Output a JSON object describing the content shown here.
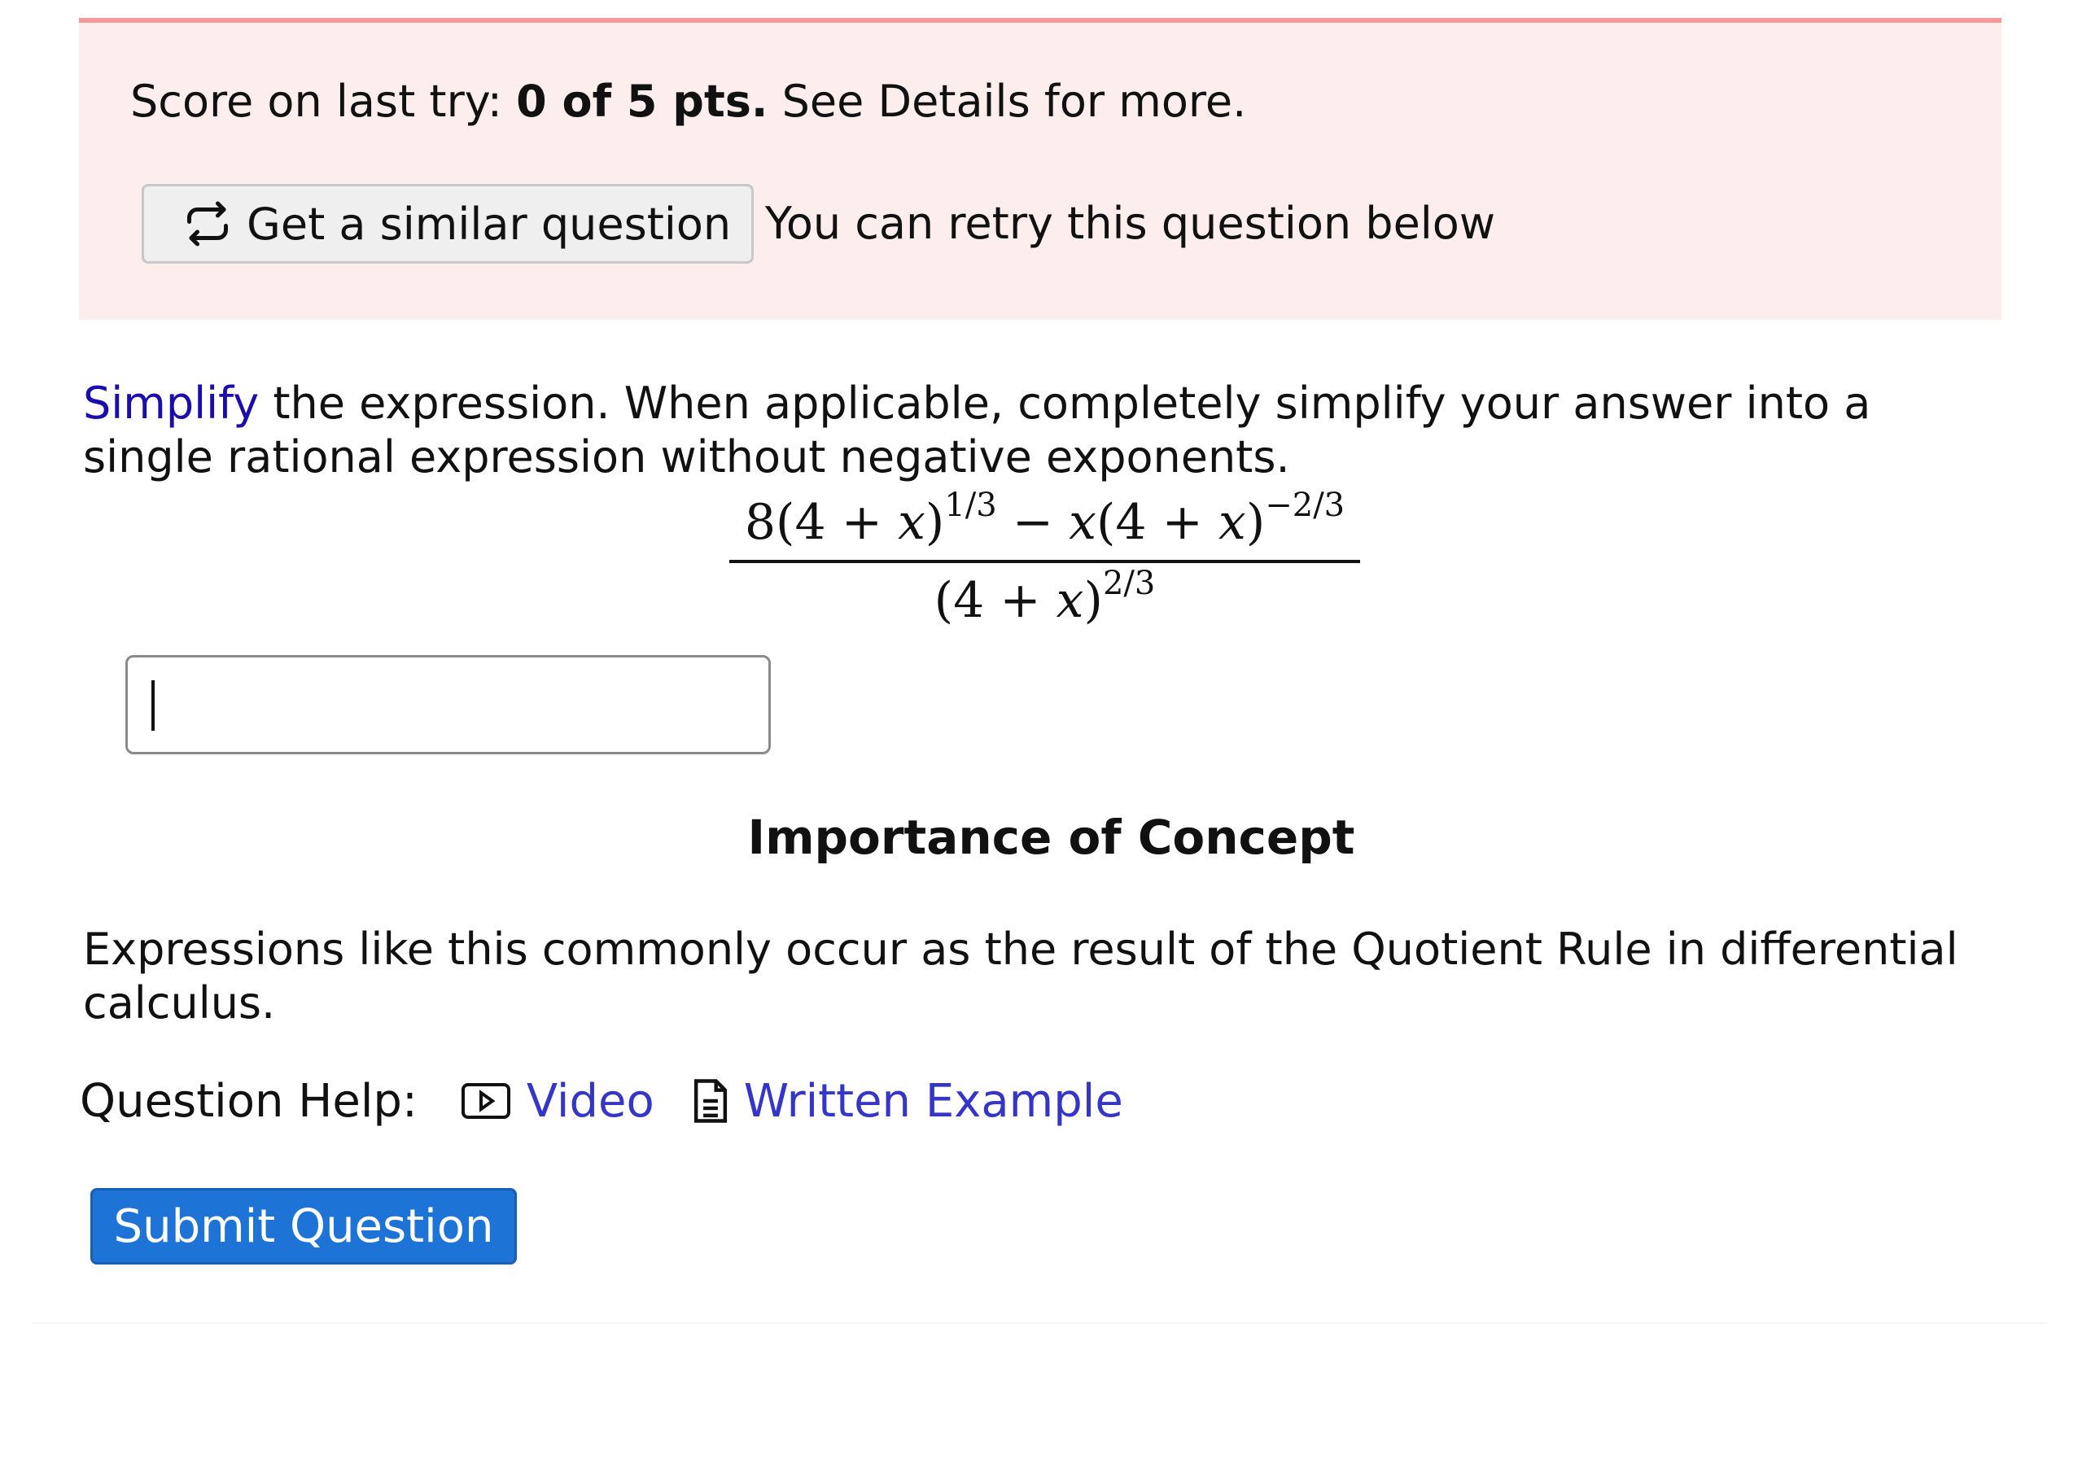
{
  "score_banner": {
    "prefix": "Score on last try: ",
    "score": "0 of 5 pts.",
    "suffix": " See Details for more.",
    "similar_button_label": "Get a similar question",
    "retry_note": "You can retry this question below",
    "colors": {
      "background": "#fdeeee",
      "border": "#f59a9a"
    }
  },
  "question": {
    "link_word": "Simplify",
    "text_rest": " the expression. When applicable, completely simplify your answer into a single rational expression without negative exponents.",
    "expression": {
      "numerator": {
        "coef": "8(4 + ",
        "var1": "x",
        "close1": ")",
        "exp1": "1/3",
        "minus": " − ",
        "var2": "x",
        "open2": "(4 + ",
        "var3": "x",
        "close2": ")",
        "exp2": "−2/3"
      },
      "denominator": {
        "open": "(4 + ",
        "var": "x",
        "close": ")",
        "exp": "2/3"
      }
    },
    "answer": {
      "value": "",
      "placeholder": ""
    }
  },
  "concept": {
    "heading": "Importance of Concept",
    "body": "Expressions like this commonly occur as the result of the Quotient Rule in differential calculus."
  },
  "help": {
    "label": "Question Help:",
    "video_label": "Video",
    "video_icon": "video-play-icon",
    "written_label": "Written Example",
    "written_icon": "document-icon"
  },
  "submit": {
    "label": "Submit Question",
    "color": "#1e73d6"
  }
}
